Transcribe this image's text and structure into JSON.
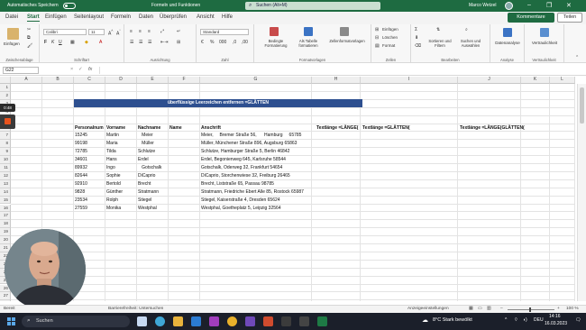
{
  "titlebar": {
    "autosave": "Automatisches Speichern",
    "savestate": "",
    "document": "Formeln und Funktionen",
    "search_placeholder": "Suchen (Alt+M)",
    "user": "Marco Wetzel"
  },
  "tabs": [
    "Datei",
    "Start",
    "Einfügen",
    "Seitenlayout",
    "Formeln",
    "Daten",
    "Überprüfen",
    "Ansicht",
    "Hilfe"
  ],
  "active_tab": "Start",
  "actions": {
    "comments": "Kommentare",
    "share": "Teilen"
  },
  "ribbon": {
    "clipboard": {
      "paste": "Einfügen",
      "label": "Zwischenablage"
    },
    "font": {
      "name": "Calibri",
      "size": "11",
      "label": "Schriftart"
    },
    "alignment": {
      "label": "Ausrichtung"
    },
    "number": {
      "format": "Standard",
      "label": "Zahl"
    },
    "styles": {
      "conditional": "Bedingte Formatierung",
      "as_table": "Als Tabelle formatieren",
      "cell_styles": "Zellenformatvorlagen",
      "label": "Formatvorlagen"
    },
    "cells": {
      "insert": "Einfügen",
      "delete": "Löschen",
      "format": "Format",
      "label": "Zellen"
    },
    "editing": {
      "sort": "Sortieren und Filtern",
      "find": "Suchen und Auswählen",
      "label": "Bearbeiten"
    },
    "analysis": {
      "data_analysis": "Datenanalyse",
      "label": "Analyse"
    },
    "sensitivity": {
      "name": "Vertraulichkeit",
      "label": "Vertraulichkeit"
    }
  },
  "formula_bar": {
    "cell_ref": "G22",
    "fx": "fx",
    "cancel": "×",
    "confirm": "✓",
    "content": ""
  },
  "columns": [
    "A",
    "B",
    "C",
    "D",
    "E",
    "F",
    "G",
    "H",
    "I",
    "J",
    "K",
    "L"
  ],
  "row_numbers": [
    "1",
    "2",
    "3",
    "4",
    "5",
    "6",
    "7",
    "8",
    "9",
    "10",
    "11",
    "12",
    "13",
    "14",
    "15",
    "16",
    "17",
    "18",
    "19",
    "20",
    "21",
    "22",
    "23",
    "24",
    "25",
    "26",
    "27",
    "28",
    "29"
  ],
  "sheet": {
    "title": "überflüssige Leerzeichen entfernen =GLÄTTEN",
    "headers": {
      "c": "Personalnum",
      "d": "Vorname",
      "e": "Nachname",
      "f": "Name",
      "g": "Anschrift",
      "h": "Textlänge =LÄNGE(",
      "i": "Textlänge =GLÄTTEN(",
      "j": "Textlänge =LÄNGE(GLÄTTEN("
    },
    "rows": [
      {
        "c": "15245",
        "d": "Martin",
        "e": "   Meier",
        "g": "Meier,     Bremer Straße 56,      Hamburg     65785"
      },
      {
        "c": "99198",
        "d": "Maria",
        "e": "   Müller",
        "g": "Müller, Münchener Straße 896, Augsburg 65863"
      },
      {
        "c": "72785",
        "d": "Tilda",
        "e": "Schlutze",
        "g": "Schlutze, Hamburger Straße 5, Berlin 46842"
      },
      {
        "c": "34601",
        "d": "Hans",
        "e": "Erdel",
        "g": "Erdel, Begonienweg 645, Karlsruhe 58544"
      },
      {
        "c": "89932",
        "d": "Ingo",
        "e": "   Gotschalk",
        "g": "Gotschalk, Oderweg 32, Frankfurt 54654"
      },
      {
        "c": "82644",
        "d": "Sophie",
        "e": "DiCaprio",
        "g": "DiCaprio, Storchenwiese 32, Freiburg 26465"
      },
      {
        "c": "92910",
        "d": "Bertold",
        "e": "Brecht",
        "g": "Brecht, Liststraße 65, Passau 98785"
      },
      {
        "c": "9828",
        "d": "Günther",
        "e": "Stratmann",
        "g": "Stratmann, Friedriche Ebert Alle 85, Rostock 65987"
      },
      {
        "c": "23534",
        "d": "Rolph",
        "e": "Stiegel",
        "g": "Stiegel, Kaiserstraße 4, Dresden 65624"
      },
      {
        "c": "27559",
        "d": "Monika",
        "e": "Westphal",
        "g": "Westphal, Goetheplatz 5, Leipzig 32564"
      }
    ]
  },
  "recorder": {
    "time": "0:48"
  },
  "statusbar": {
    "ready": "Bereit",
    "accessibility": "Barrierefreiheit: Untersuchen",
    "display": "Anzeigeeinstellungen",
    "zoom": "100 %"
  },
  "taskbar": {
    "search": "Suchen",
    "weather": "8°C  Stark bewölkt",
    "lang": "DEU",
    "time": "14:16",
    "date": "16.03.2023"
  },
  "colors": {
    "excel_green": "#1e6b41",
    "title_fill": "#2d4f8f",
    "taskbar": "#1b1f2a"
  }
}
